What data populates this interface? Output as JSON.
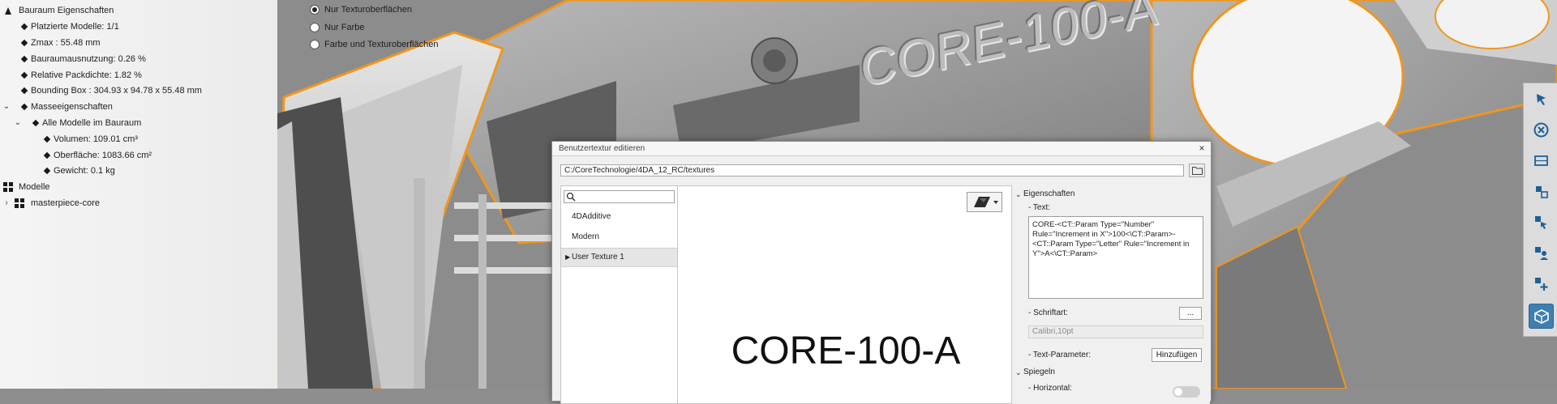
{
  "tree": {
    "items": [
      {
        "label": "Bauraum Eigenschaften",
        "level": 0,
        "kind": "group",
        "expander": "none"
      },
      {
        "label": "Platzierte Modelle: 1/1",
        "level": 1,
        "kind": "bullet"
      },
      {
        "label": "Zmax : 55.48 mm",
        "level": 1,
        "kind": "bullet"
      },
      {
        "label": "Bauraumausnutzung: 0.26 %",
        "level": 1,
        "kind": "bullet"
      },
      {
        "label": "Relative Packdichte: 1.82 %",
        "level": 1,
        "kind": "bullet"
      },
      {
        "label": "Bounding Box : 304.93 x 94.78 x 55.48 mm",
        "level": 1,
        "kind": "bullet"
      },
      {
        "label": "Masseeigenschaften",
        "level": 1,
        "kind": "bullet",
        "expander": "open"
      },
      {
        "label": "Alle Modelle im Bauraum",
        "level": 2,
        "kind": "bullet",
        "expander": "open"
      },
      {
        "label": "Volumen: 109.01 cm³",
        "level": 3,
        "kind": "bullet"
      },
      {
        "label": "Oberfläche: 1083.66 cm²",
        "level": 3,
        "kind": "bullet"
      },
      {
        "label": "Gewicht: 0.1 kg",
        "level": 3,
        "kind": "bullet"
      },
      {
        "label": "Modelle",
        "level": 0,
        "kind": "group"
      },
      {
        "label": "masterpiece-core",
        "level": 0,
        "kind": "group",
        "expander": "closed"
      }
    ]
  },
  "radio_group": {
    "options": [
      {
        "label": "Nur Texturoberflächen",
        "checked": true
      },
      {
        "label": "Nur Farbe",
        "checked": false
      },
      {
        "label": "Farbe und Texturoberflächen",
        "checked": false
      }
    ]
  },
  "viewport": {
    "part_label": "CORE-100-A",
    "highlight_color": "#f0961e"
  },
  "dialog": {
    "title": "Benutzertextur editieren",
    "close_glyph": "×",
    "path": "C:/CoreTechnologie/4DA_12_RC/textures",
    "search_placeholder": "",
    "list": [
      {
        "label": "4DAdditive",
        "selected": false
      },
      {
        "label": "Modern",
        "selected": false
      },
      {
        "label": "User Texture 1",
        "selected": true
      }
    ],
    "preview_text": "CORE-100-A",
    "properties": {
      "section_title": "Eigenschaften",
      "text_label": "- Text:",
      "text_value": "CORE-<CT::Param Type=\"Number\" Rule=\"Increment in X\">100<\\CT::Param>-<CT::Param Type=\"Letter\" Rule=\"Increment in Y\">A<\\CT::Param>",
      "font_label": "- Schriftart:",
      "font_button": "...",
      "font_value": "Calibri,10pt",
      "params_label": "- Text-Parameter:",
      "add_button": "Hinzufügen",
      "mirror_section": "Spiegeln",
      "horizontal_label": "- Horizontal:"
    }
  },
  "toolbar": {
    "buttons": [
      {
        "icon": "select-arrow-icon",
        "active": false
      },
      {
        "icon": "cancel-circle-icon",
        "active": false
      },
      {
        "icon": "bounding-frame-icon",
        "active": false
      },
      {
        "icon": "move-parts-icon",
        "active": false
      },
      {
        "icon": "pick-part-icon",
        "active": false
      },
      {
        "icon": "person-part-icon",
        "active": false
      },
      {
        "icon": "add-part-icon",
        "active": false
      },
      {
        "icon": "build-box-icon",
        "active": true
      }
    ]
  }
}
